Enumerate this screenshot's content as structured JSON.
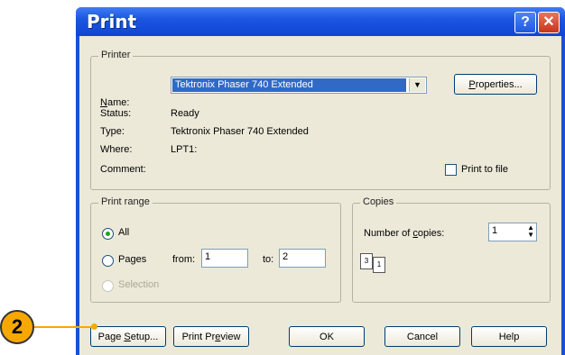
{
  "window": {
    "title": "Print"
  },
  "printer": {
    "legend": "Printer",
    "name_label": "Name:",
    "name_value": "Tektronix Phaser 740 Extended",
    "properties_label": "Properties...",
    "status_label": "Status:",
    "status_value": "Ready",
    "type_label": "Type:",
    "type_value": "Tektronix Phaser 740 Extended",
    "where_label": "Where:",
    "where_value": "LPT1:",
    "comment_label": "Comment:",
    "print_to_file_label": "Print to file"
  },
  "print_range": {
    "legend": "Print range",
    "all_label": "All",
    "pages_label": "Pages",
    "from_label": "from:",
    "from_value": "1",
    "to_label": "to:",
    "to_value": "2",
    "selection_label": "Selection"
  },
  "copies": {
    "legend": "Copies",
    "number_label": "Number of copies:",
    "number_value": "1"
  },
  "buttons": {
    "page_setup": "Page Setup...",
    "print_preview": "Print Preview",
    "ok": "OK",
    "cancel": "Cancel",
    "help": "Help"
  },
  "callout": {
    "number": "2"
  },
  "colors": {
    "accent": "#f7a800",
    "titlebar": "#1d56e0",
    "selection": "#316ac5"
  }
}
